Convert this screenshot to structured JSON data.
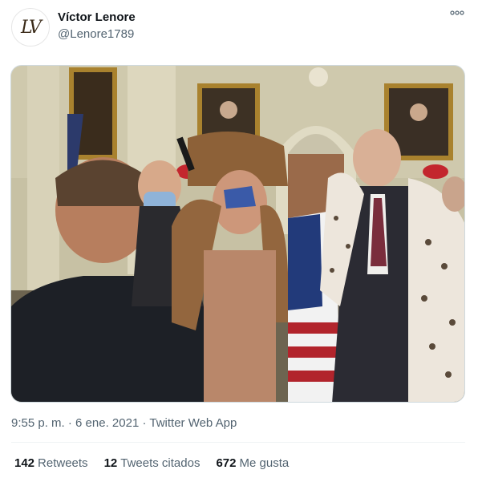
{
  "author": {
    "name": "Víctor Lenore",
    "handle": "@Lenore1789",
    "avatar_monogram": "LV"
  },
  "more_icon": "more-horizontal-icon",
  "media": {
    "kind": "photo"
  },
  "meta": {
    "time": "9:55 p. m.",
    "separator": " · ",
    "date": "6 ene. 2021",
    "source": "Twitter Web App"
  },
  "stats": {
    "retweets_count": "142",
    "retweets_label": "Retweets",
    "quotes_count": "12",
    "quotes_label": "Tweets citados",
    "likes_count": "672",
    "likes_label": "Me gusta"
  },
  "colors": {
    "text_primary": "#0f1419",
    "text_secondary": "#536471",
    "border": "#cfd9de"
  }
}
